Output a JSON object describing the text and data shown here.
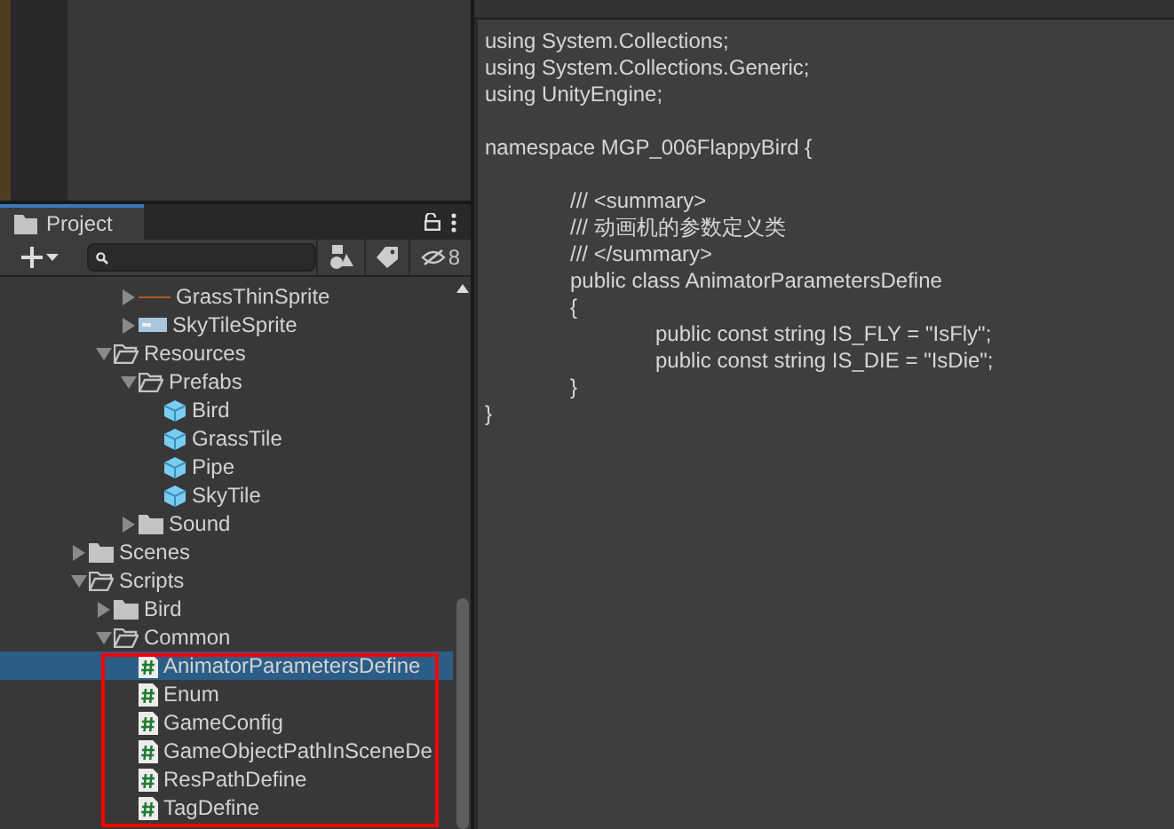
{
  "project_panel": {
    "tab": {
      "label": "Project",
      "selected": true
    },
    "toolbar": {
      "hidden_count": "8"
    },
    "tree": [
      {
        "children": [
          {
            "children": [
              {
                "label": "GrassThinSprite",
                "kind": "line-sprite",
                "expanded": false,
                "selected": false
              },
              {
                "label": "SkyTileSprite",
                "kind": "sprite",
                "expanded": false,
                "selected": false
              }
            ]
          },
          {
            "label": "Resources",
            "kind": "folder",
            "expanded": true,
            "selected": false,
            "children": [
              {
                "label": "Prefabs",
                "kind": "folder",
                "expanded": true,
                "selected": false,
                "children": [
                  {
                    "label": "Bird",
                    "kind": "prefab",
                    "selected": false
                  },
                  {
                    "label": "GrassTile",
                    "kind": "prefab",
                    "selected": false
                  },
                  {
                    "label": "Pipe",
                    "kind": "prefab",
                    "selected": false
                  },
                  {
                    "label": "SkyTile",
                    "kind": "prefab",
                    "selected": false
                  }
                ]
              },
              {
                "label": "Sound",
                "kind": "folder",
                "expanded": false,
                "selected": false
              }
            ]
          }
        ]
      },
      {
        "label": "Scenes",
        "kind": "folder",
        "expanded": false,
        "selected": false
      },
      {
        "label": "Scripts",
        "kind": "folder",
        "expanded": true,
        "selected": false,
        "children": [
          {
            "label": "Bird",
            "kind": "folder",
            "expanded": false,
            "selected": false
          },
          {
            "label": "Common",
            "kind": "folder",
            "expanded": true,
            "selected": false,
            "children": [
              {
                "label": "AnimatorParametersDefine",
                "kind": "script",
                "selected": true
              },
              {
                "label": "Enum",
                "kind": "script",
                "selected": false
              },
              {
                "label": "GameConfig",
                "kind": "script",
                "selected": false
              },
              {
                "label": "GameObjectPathInSceneDe",
                "kind": "script",
                "selected": false
              },
              {
                "label": "ResPathDefine",
                "kind": "script",
                "selected": false
              },
              {
                "label": "TagDefine",
                "kind": "script",
                "selected": false
              }
            ]
          }
        ]
      }
    ]
  },
  "code_preview": {
    "text": "using System.Collections;\nusing System.Collections.Generic;\nusing UnityEngine;\n\nnamespace MGP_006FlappyBird {\n\n\t/// <summary>\n\t/// 动画机的参数定义类\n\t/// </summary>\n\tpublic class AnimatorParametersDefine\n\t{\n\t\tpublic const string IS_FLY = \"IsFly\";\n\t\tpublic const string IS_DIE = \"IsDie\";\n\t}\n}"
  }
}
